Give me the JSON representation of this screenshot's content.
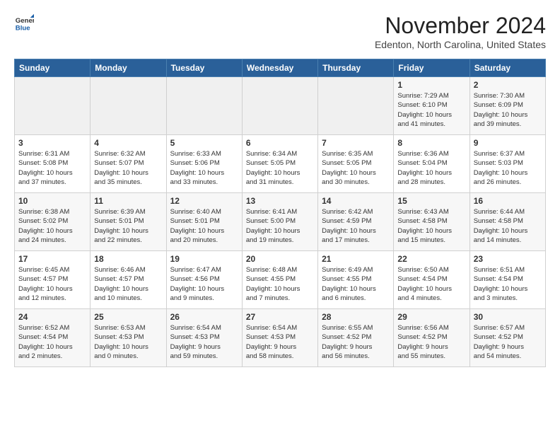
{
  "logo": {
    "line1": "General",
    "line2": "Blue"
  },
  "header": {
    "month": "November 2024",
    "location": "Edenton, North Carolina, United States"
  },
  "weekdays": [
    "Sunday",
    "Monday",
    "Tuesday",
    "Wednesday",
    "Thursday",
    "Friday",
    "Saturday"
  ],
  "weeks": [
    [
      {
        "day": "",
        "info": ""
      },
      {
        "day": "",
        "info": ""
      },
      {
        "day": "",
        "info": ""
      },
      {
        "day": "",
        "info": ""
      },
      {
        "day": "",
        "info": ""
      },
      {
        "day": "1",
        "info": "Sunrise: 7:29 AM\nSunset: 6:10 PM\nDaylight: 10 hours\nand 41 minutes."
      },
      {
        "day": "2",
        "info": "Sunrise: 7:30 AM\nSunset: 6:09 PM\nDaylight: 10 hours\nand 39 minutes."
      }
    ],
    [
      {
        "day": "3",
        "info": "Sunrise: 6:31 AM\nSunset: 5:08 PM\nDaylight: 10 hours\nand 37 minutes."
      },
      {
        "day": "4",
        "info": "Sunrise: 6:32 AM\nSunset: 5:07 PM\nDaylight: 10 hours\nand 35 minutes."
      },
      {
        "day": "5",
        "info": "Sunrise: 6:33 AM\nSunset: 5:06 PM\nDaylight: 10 hours\nand 33 minutes."
      },
      {
        "day": "6",
        "info": "Sunrise: 6:34 AM\nSunset: 5:05 PM\nDaylight: 10 hours\nand 31 minutes."
      },
      {
        "day": "7",
        "info": "Sunrise: 6:35 AM\nSunset: 5:05 PM\nDaylight: 10 hours\nand 30 minutes."
      },
      {
        "day": "8",
        "info": "Sunrise: 6:36 AM\nSunset: 5:04 PM\nDaylight: 10 hours\nand 28 minutes."
      },
      {
        "day": "9",
        "info": "Sunrise: 6:37 AM\nSunset: 5:03 PM\nDaylight: 10 hours\nand 26 minutes."
      }
    ],
    [
      {
        "day": "10",
        "info": "Sunrise: 6:38 AM\nSunset: 5:02 PM\nDaylight: 10 hours\nand 24 minutes."
      },
      {
        "day": "11",
        "info": "Sunrise: 6:39 AM\nSunset: 5:01 PM\nDaylight: 10 hours\nand 22 minutes."
      },
      {
        "day": "12",
        "info": "Sunrise: 6:40 AM\nSunset: 5:01 PM\nDaylight: 10 hours\nand 20 minutes."
      },
      {
        "day": "13",
        "info": "Sunrise: 6:41 AM\nSunset: 5:00 PM\nDaylight: 10 hours\nand 19 minutes."
      },
      {
        "day": "14",
        "info": "Sunrise: 6:42 AM\nSunset: 4:59 PM\nDaylight: 10 hours\nand 17 minutes."
      },
      {
        "day": "15",
        "info": "Sunrise: 6:43 AM\nSunset: 4:58 PM\nDaylight: 10 hours\nand 15 minutes."
      },
      {
        "day": "16",
        "info": "Sunrise: 6:44 AM\nSunset: 4:58 PM\nDaylight: 10 hours\nand 14 minutes."
      }
    ],
    [
      {
        "day": "17",
        "info": "Sunrise: 6:45 AM\nSunset: 4:57 PM\nDaylight: 10 hours\nand 12 minutes."
      },
      {
        "day": "18",
        "info": "Sunrise: 6:46 AM\nSunset: 4:57 PM\nDaylight: 10 hours\nand 10 minutes."
      },
      {
        "day": "19",
        "info": "Sunrise: 6:47 AM\nSunset: 4:56 PM\nDaylight: 10 hours\nand 9 minutes."
      },
      {
        "day": "20",
        "info": "Sunrise: 6:48 AM\nSunset: 4:55 PM\nDaylight: 10 hours\nand 7 minutes."
      },
      {
        "day": "21",
        "info": "Sunrise: 6:49 AM\nSunset: 4:55 PM\nDaylight: 10 hours\nand 6 minutes."
      },
      {
        "day": "22",
        "info": "Sunrise: 6:50 AM\nSunset: 4:54 PM\nDaylight: 10 hours\nand 4 minutes."
      },
      {
        "day": "23",
        "info": "Sunrise: 6:51 AM\nSunset: 4:54 PM\nDaylight: 10 hours\nand 3 minutes."
      }
    ],
    [
      {
        "day": "24",
        "info": "Sunrise: 6:52 AM\nSunset: 4:54 PM\nDaylight: 10 hours\nand 2 minutes."
      },
      {
        "day": "25",
        "info": "Sunrise: 6:53 AM\nSunset: 4:53 PM\nDaylight: 10 hours\nand 0 minutes."
      },
      {
        "day": "26",
        "info": "Sunrise: 6:54 AM\nSunset: 4:53 PM\nDaylight: 9 hours\nand 59 minutes."
      },
      {
        "day": "27",
        "info": "Sunrise: 6:54 AM\nSunset: 4:53 PM\nDaylight: 9 hours\nand 58 minutes."
      },
      {
        "day": "28",
        "info": "Sunrise: 6:55 AM\nSunset: 4:52 PM\nDaylight: 9 hours\nand 56 minutes."
      },
      {
        "day": "29",
        "info": "Sunrise: 6:56 AM\nSunset: 4:52 PM\nDaylight: 9 hours\nand 55 minutes."
      },
      {
        "day": "30",
        "info": "Sunrise: 6:57 AM\nSunset: 4:52 PM\nDaylight: 9 hours\nand 54 minutes."
      }
    ]
  ]
}
